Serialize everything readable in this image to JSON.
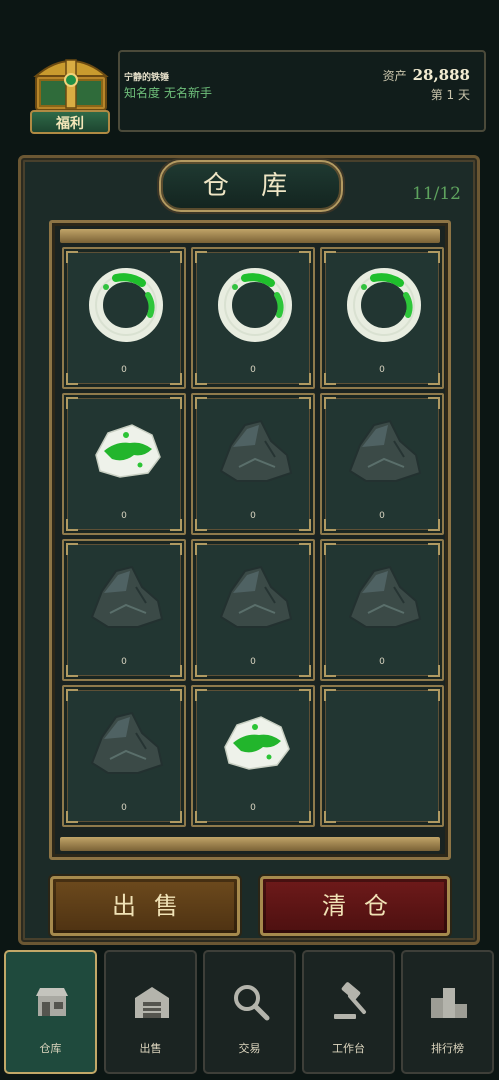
{
  "header": {
    "welfare_label": "福利",
    "player_name": "宁静的铁锤",
    "fame_label": "知名度",
    "fame_value": "无名新手",
    "assets_label": "资产",
    "assets_value": "28,888",
    "day_label": "第 1 天"
  },
  "warehouse": {
    "title": "仓 库",
    "capacity": "11/12",
    "slots": [
      {
        "icon": "jade-bangle-icon",
        "qty": "0"
      },
      {
        "icon": "jade-bangle-icon",
        "qty": "0"
      },
      {
        "icon": "jade-bangle-icon",
        "qty": "0"
      },
      {
        "icon": "green-jade-stone-icon",
        "qty": "0"
      },
      {
        "icon": "raw-stone-icon",
        "qty": "0"
      },
      {
        "icon": "raw-stone-icon",
        "qty": "0"
      },
      {
        "icon": "raw-stone-icon",
        "qty": "0"
      },
      {
        "icon": "raw-stone-icon",
        "qty": "0"
      },
      {
        "icon": "raw-stone-icon",
        "qty": "0"
      },
      {
        "icon": "raw-stone-icon",
        "qty": "0"
      },
      {
        "icon": "green-jade-stone-icon",
        "qty": "0"
      },
      {
        "icon": "empty",
        "qty": ""
      }
    ]
  },
  "actions": {
    "sell_label": "出售",
    "clear_label": "清仓"
  },
  "nav": {
    "items": [
      {
        "label": "仓库",
        "icon": "shop-icon",
        "active": true
      },
      {
        "label": "出售",
        "icon": "warehouse-icon",
        "active": false
      },
      {
        "label": "交易",
        "icon": "magnifier-icon",
        "active": false
      },
      {
        "label": "工作台",
        "icon": "gavel-icon",
        "active": false
      },
      {
        "label": "排行榜",
        "icon": "podium-icon",
        "active": false
      }
    ]
  },
  "colors": {
    "background": "#0c1614",
    "gold_border": "#a68a4d",
    "jade_green": "#2fbf3a",
    "fame_text": "#6fc07b",
    "sell_button": "#6d4a1d",
    "clear_button": "#6e1a1a",
    "active_tab": "#1f4a3d"
  }
}
